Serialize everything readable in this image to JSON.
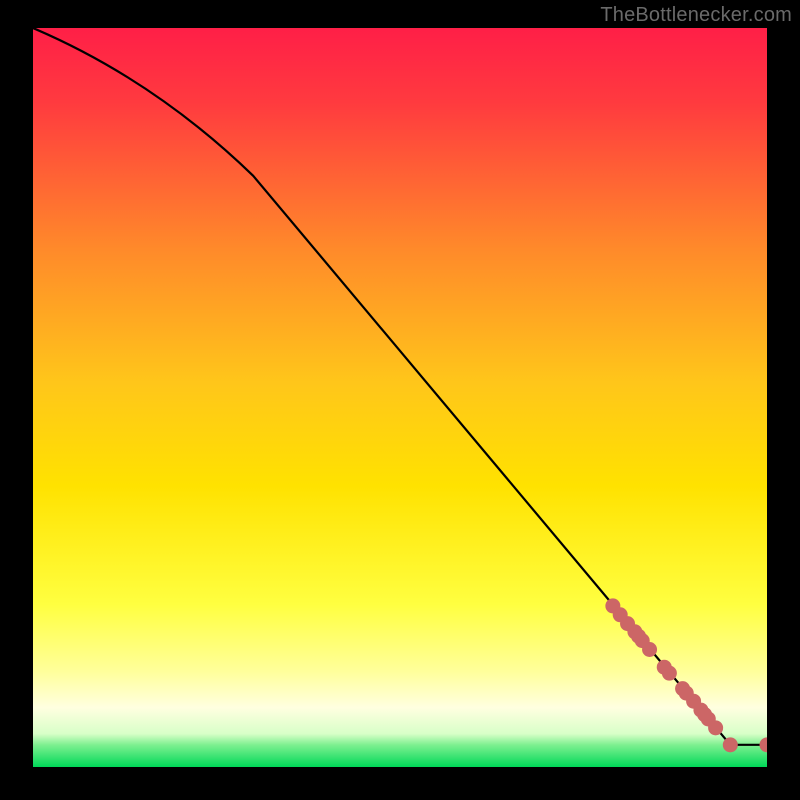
{
  "attribution": "TheBottlenecker.com",
  "colors": {
    "gradient_top": "#ff1f47",
    "gradient_mid1": "#ff8a2a",
    "gradient_mid2": "#ffe200",
    "gradient_mid3": "#ffff66",
    "gradient_mid4": "#ffffd0",
    "gradient_bottom": "#00e05a",
    "line": "#000000",
    "marker": "#cc6666",
    "frame": "#000000"
  },
  "chart_data": {
    "type": "line",
    "title": "",
    "xlabel": "",
    "ylabel": "",
    "xlim": [
      0,
      100
    ],
    "ylim": [
      0,
      100
    ],
    "grid": false,
    "legend": false,
    "line_points": [
      {
        "x": 0,
        "y": 100
      },
      {
        "x": 30,
        "y": 80
      },
      {
        "x": 95,
        "y": 3
      },
      {
        "x": 100,
        "y": 3
      }
    ],
    "markers": [
      {
        "x": 79,
        "y": 21.8
      },
      {
        "x": 80,
        "y": 20.6
      },
      {
        "x": 81,
        "y": 19.4
      },
      {
        "x": 82,
        "y": 18.3
      },
      {
        "x": 82.5,
        "y": 17.7
      },
      {
        "x": 83,
        "y": 17.1
      },
      {
        "x": 84,
        "y": 15.9
      },
      {
        "x": 86,
        "y": 13.5
      },
      {
        "x": 86.7,
        "y": 12.7
      },
      {
        "x": 88.5,
        "y": 10.6
      },
      {
        "x": 89,
        "y": 10.0
      },
      {
        "x": 90,
        "y": 8.9
      },
      {
        "x": 91,
        "y": 7.7
      },
      {
        "x": 91.5,
        "y": 7.1
      },
      {
        "x": 92,
        "y": 6.5
      },
      {
        "x": 93,
        "y": 5.3
      },
      {
        "x": 95,
        "y": 3
      },
      {
        "x": 100,
        "y": 3
      }
    ]
  }
}
